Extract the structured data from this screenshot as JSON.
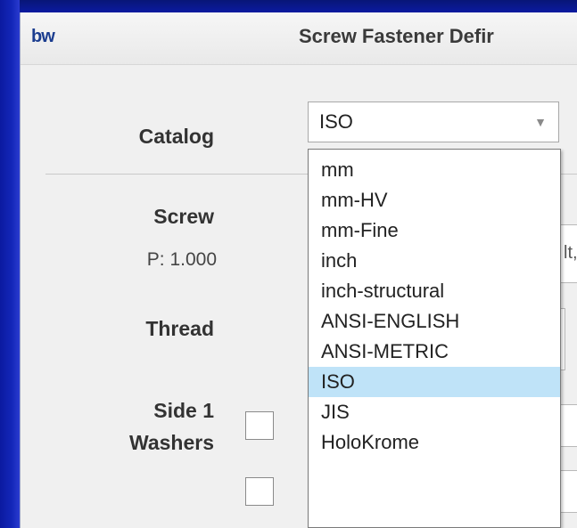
{
  "window": {
    "logo": "bw",
    "title": "Screw Fastener Defir"
  },
  "form": {
    "catalog_label": "Catalog",
    "screw_label": "Screw",
    "pitch_text": "P: 1.000",
    "thread_label": "Thread",
    "side1_label": "Side 1",
    "washers_label": "Washers",
    "screw_field_peek": "lt,"
  },
  "catalog": {
    "selected": "ISO",
    "options": [
      "mm",
      "mm-HV",
      "mm-Fine",
      "inch",
      "inch-structural",
      "ANSI-ENGLISH",
      "ANSI-METRIC",
      "ISO",
      "JIS",
      "HoloKrome"
    ],
    "highlighted_index": 7
  },
  "colors": {
    "desktop": "#0a1a8c",
    "highlight": "#bfe3f8"
  }
}
